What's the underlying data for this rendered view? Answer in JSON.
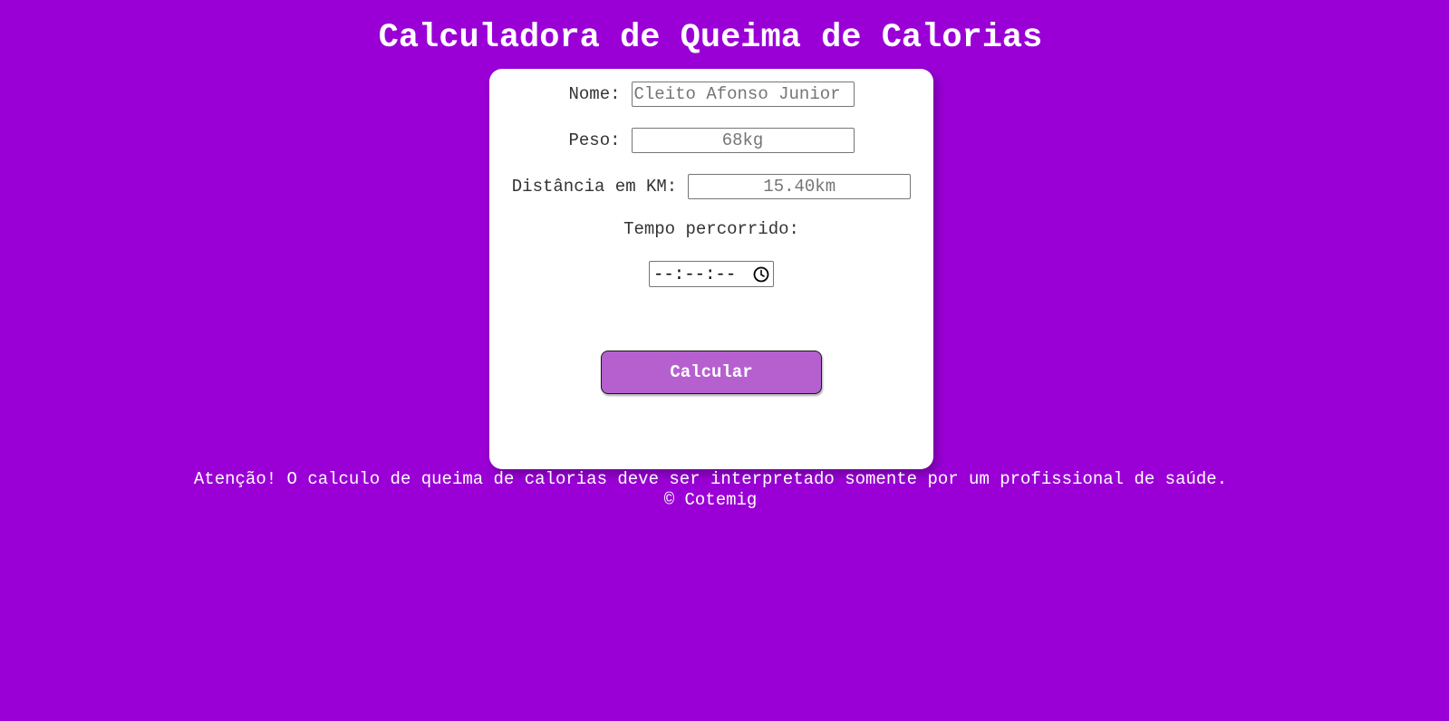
{
  "header": {
    "title": "Calculadora de Queima de Calorias"
  },
  "form": {
    "nome": {
      "label": "Nome:",
      "placeholder": "Cleito Afonso Junior"
    },
    "peso": {
      "label": "Peso:",
      "placeholder": "68kg"
    },
    "distancia": {
      "label": "Distância em KM:",
      "placeholder": "15.40km"
    },
    "tempo": {
      "label": "Tempo percorrido:",
      "value_display": "--:--:--",
      "icon": "clock-icon"
    },
    "submit_label": "Calcular"
  },
  "footer": {
    "warning": "Atenção! O calculo de queima de calorias deve ser interpretado somente por um profissional de saúde.",
    "copyright": "© Cotemig"
  },
  "colors": {
    "background": "#9a00d6",
    "card": "#ffffff",
    "button": "#b660d0",
    "text_light": "#ffffff"
  }
}
